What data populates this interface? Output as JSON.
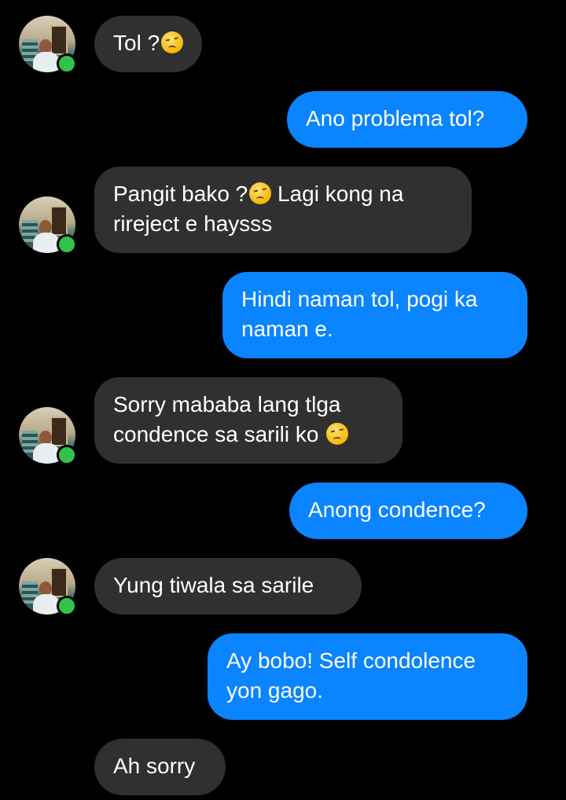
{
  "contact": {
    "online_status": "online"
  },
  "messages": [
    {
      "direction": "in",
      "text": "Tol ?",
      "emoji": "pensive-face"
    },
    {
      "direction": "out",
      "text": "Ano problema tol?"
    },
    {
      "direction": "in",
      "line1": "Pangit bako ?",
      "line1_emoji": "pensive-face",
      "line1_rest": " Lagi kong na",
      "line2": "rireject e haysss"
    },
    {
      "direction": "out",
      "line1": "Hindi naman tol, pogi ka",
      "line2": "naman e."
    },
    {
      "direction": "in",
      "line1": "Sorry mababa lang tlga",
      "line2": "condence sa sarili ko ",
      "emoji": "pensive-face"
    },
    {
      "direction": "out",
      "text": "Anong condence?"
    },
    {
      "direction": "in",
      "text": "Yung tiwala sa sarile"
    },
    {
      "direction": "out",
      "line1": "Ay bobo! Self condolence",
      "line2": "yon gago."
    },
    {
      "direction": "in",
      "text": "Ah sorry"
    }
  ],
  "colors": {
    "background": "#000000",
    "incoming_bubble": "#303030",
    "outgoing_bubble": "#0a84ff",
    "online_indicator": "#31c24a"
  }
}
